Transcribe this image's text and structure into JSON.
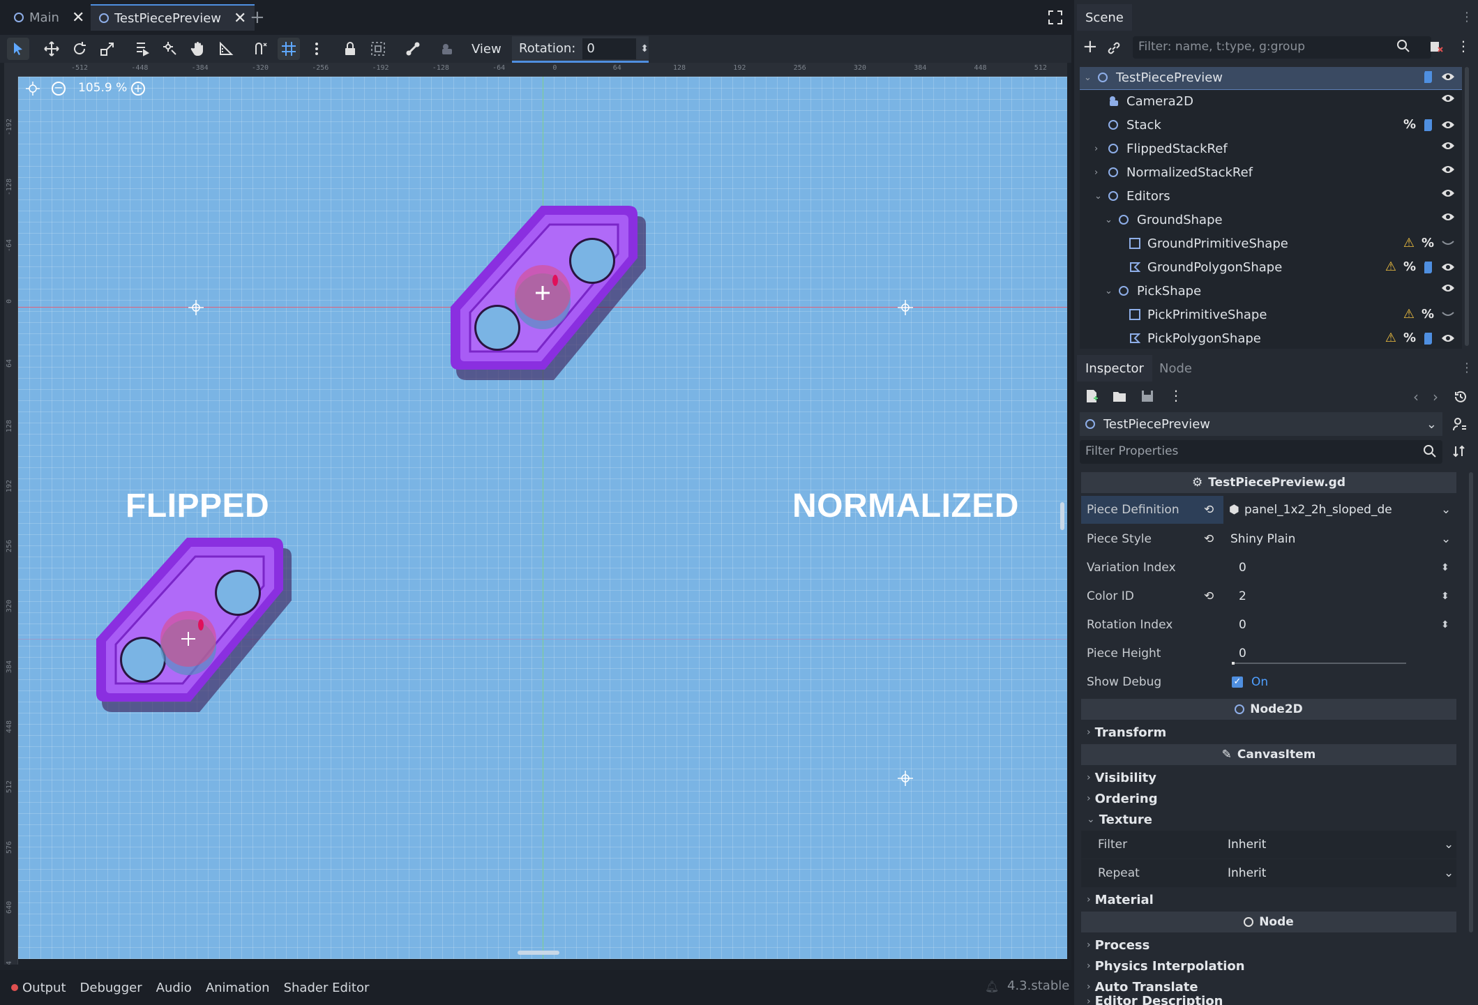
{
  "tabs": [
    {
      "label": "Main",
      "active": false
    },
    {
      "label": "TestPiecePreview",
      "active": true
    }
  ],
  "toolbar": {
    "view_label": "View",
    "rotation_label": "Rotation:",
    "rotation_value": "0"
  },
  "viewport": {
    "zoom": "105.9 %",
    "label_left": "FLIPPED",
    "label_right": "NORMALIZED",
    "ruler_top_ticks": [
      "-512",
      "-448",
      "-384",
      "-320",
      "-256",
      "-192",
      "-128",
      "-64",
      "0",
      "64",
      "128",
      "192",
      "256",
      "320",
      "384",
      "448",
      "512"
    ],
    "ruler_left_ticks": [
      "-192",
      "-128",
      "-64",
      "0",
      "64",
      "128",
      "192",
      "256",
      "320",
      "384",
      "448",
      "512",
      "576",
      "640",
      "704"
    ]
  },
  "bottom": {
    "tabs": [
      "Output",
      "Debugger",
      "Audio",
      "Animation",
      "Shader Editor"
    ],
    "version": "4.3.stable"
  },
  "scene": {
    "tab_label": "Scene",
    "filter_placeholder": "Filter: name, t:type, g:group",
    "tree": [
      {
        "label": "TestPiecePreview",
        "depth": 0,
        "expand": "v",
        "icon": "node2d-icon",
        "script": true,
        "pct": false,
        "warn": false
      },
      {
        "label": "Camera2D",
        "depth": 1,
        "expand": "",
        "icon": "camera-icon",
        "script": false,
        "pct": false,
        "warn": false
      },
      {
        "label": "Stack",
        "depth": 1,
        "expand": "",
        "icon": "node2d-icon",
        "script": true,
        "pct": true,
        "warn": false
      },
      {
        "label": "FlippedStackRef",
        "depth": 1,
        "expand": ">",
        "icon": "node2d-icon",
        "script": false,
        "pct": false,
        "warn": false
      },
      {
        "label": "NormalizedStackRef",
        "depth": 1,
        "expand": ">",
        "icon": "node2d-icon",
        "script": false,
        "pct": false,
        "warn": false
      },
      {
        "label": "Editors",
        "depth": 1,
        "expand": "v",
        "icon": "node2d-icon",
        "script": false,
        "pct": false,
        "warn": false
      },
      {
        "label": "GroundShape",
        "depth": 2,
        "expand": "v",
        "icon": "node2d-icon",
        "script": false,
        "pct": false,
        "warn": false
      },
      {
        "label": "GroundPrimitiveShape",
        "depth": 3,
        "expand": "",
        "icon": "rect-shape-icon",
        "script": false,
        "pct": true,
        "warn": true
      },
      {
        "label": "GroundPolygonShape",
        "depth": 3,
        "expand": "",
        "icon": "polygon-shape-icon",
        "script": true,
        "pct": true,
        "warn": true
      },
      {
        "label": "PickShape",
        "depth": 2,
        "expand": "v",
        "icon": "node2d-icon",
        "script": false,
        "pct": false,
        "warn": false
      },
      {
        "label": "PickPrimitiveShape",
        "depth": 3,
        "expand": "",
        "icon": "rect-shape-icon",
        "script": false,
        "pct": true,
        "warn": true
      },
      {
        "label": "PickPolygonShape",
        "depth": 3,
        "expand": "",
        "icon": "polygon-shape-icon",
        "script": true,
        "pct": true,
        "warn": true
      }
    ]
  },
  "inspector": {
    "tab_inspector": "Inspector",
    "tab_node": "Node",
    "object_name": "TestPiecePreview",
    "filter_placeholder": "Filter Properties",
    "script_header": "TestPiecePreview.gd",
    "properties": [
      {
        "label": "Piece Definition",
        "value": "panel_1x2_2h_sloped_de",
        "revert": true,
        "kind": "resource"
      },
      {
        "label": "Piece Style",
        "value": "Shiny Plain",
        "revert": true,
        "kind": "dropdown"
      },
      {
        "label": "Variation Index",
        "value": "0",
        "revert": false,
        "kind": "spin"
      },
      {
        "label": "Color ID",
        "value": "2",
        "revert": true,
        "kind": "spin"
      },
      {
        "label": "Rotation Index",
        "value": "0",
        "revert": false,
        "kind": "spin"
      },
      {
        "label": "Piece Height",
        "value": "0",
        "revert": false,
        "kind": "slider"
      },
      {
        "label": "Show Debug",
        "value": "On",
        "revert": false,
        "kind": "checkbox"
      }
    ],
    "node2d_header": "Node2D",
    "transform_group": "Transform",
    "canvasitem_header": "CanvasItem",
    "canvas_groups": [
      "Visibility",
      "Ordering",
      "Texture"
    ],
    "texture_fields": [
      {
        "label": "Filter",
        "value": "Inherit"
      },
      {
        "label": "Repeat",
        "value": "Inherit"
      }
    ],
    "material_group": "Material",
    "node_header": "Node",
    "node_groups": [
      "Process",
      "Physics Interpolation",
      "Auto Translate",
      "Editor Description"
    ]
  },
  "colors": {
    "accent": "#4f8fe0",
    "canvas_bg": "#7ab4e4",
    "piece_purple": "#9a3ff0",
    "panel_bg": "#252a32"
  }
}
